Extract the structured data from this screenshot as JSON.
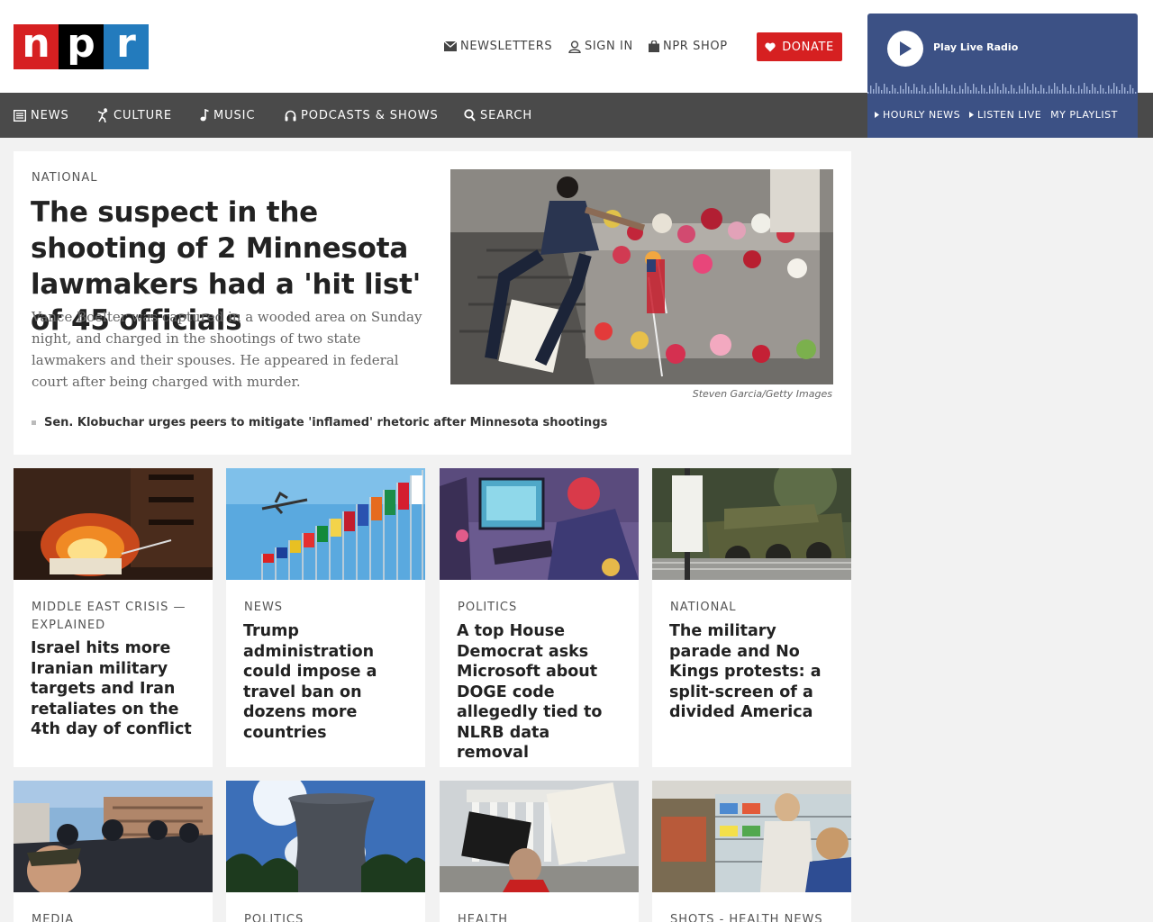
{
  "header": {
    "logo": [
      "n",
      "p",
      "r"
    ],
    "utility": [
      {
        "label": "NEWSLETTERS",
        "icon": "envelope-icon"
      },
      {
        "label": "SIGN IN",
        "icon": "user-icon"
      },
      {
        "label": "NPR SHOP",
        "icon": "shopping-bag-icon"
      }
    ],
    "donate_label": "DONATE"
  },
  "nav": [
    {
      "label": "NEWS",
      "icon": "newspaper-icon"
    },
    {
      "label": "CULTURE",
      "icon": "dancer-icon"
    },
    {
      "label": "MUSIC",
      "icon": "music-note-icon"
    },
    {
      "label": "PODCASTS & SHOWS",
      "icon": "headphones-icon"
    },
    {
      "label": "SEARCH",
      "icon": "search-icon"
    }
  ],
  "player": {
    "play_label": "Play Live Radio",
    "links": [
      "HOURLY NEWS",
      "LISTEN LIVE",
      "MY PLAYLIST"
    ]
  },
  "lead": {
    "slug": "National",
    "headline": "The suspect in the shooting of 2 Minnesota lawmakers had a 'hit list' of 45 officials",
    "teaser": "Vance Boelter was captured in a wooded area on Sunday night, and charged in the shootings of two state lawmakers and their spouses. He appeared in federal court after being charged with murder.",
    "photo_credit": "Steven Garcia/Getty Images",
    "related": "Sen. Klobuchar urges peers to mitigate 'inflamed' rhetoric after Minnesota shootings"
  },
  "cards": [
    {
      "slug": "Middle East crisis — explained",
      "headline": "Israel hits more Iranian military targets and Iran retaliates on the 4th day of conflict"
    },
    {
      "slug": "News",
      "headline": "Trump administration could impose a travel ban on dozens more countries"
    },
    {
      "slug": "Politics",
      "headline": "A top House Democrat asks Microsoft about DOGE code allegedly tied to NLRB data removal"
    },
    {
      "slug": "National",
      "headline": "The military parade and No Kings protests: a split-screen of a divided America"
    },
    {
      "slug": "Media",
      "headline": ""
    },
    {
      "slug": "Politics",
      "headline": ""
    },
    {
      "slug": "Health",
      "headline": ""
    },
    {
      "slug": "Shots - Health News",
      "headline": ""
    }
  ],
  "colors": {
    "npr_red": "#d62021",
    "npr_blue": "#237bbd",
    "nav_bg": "#4a4a4a",
    "player_bg": "#3c5185"
  }
}
